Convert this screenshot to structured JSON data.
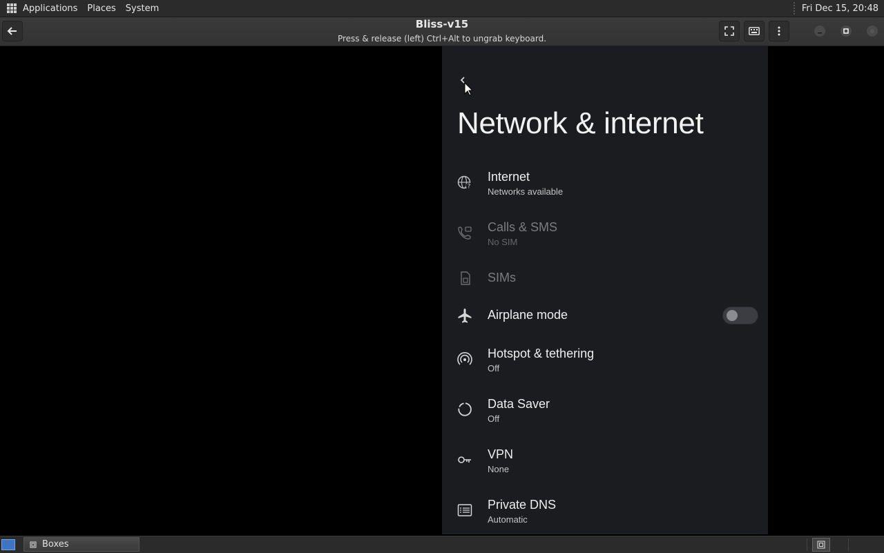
{
  "top_panel": {
    "menus": [
      "Applications",
      "Places",
      "System"
    ],
    "clock": "Fri Dec 15, 20:48"
  },
  "titlebar": {
    "title": "Bliss-v15",
    "subtitle": "Press & release (left) Ctrl+Alt to ungrab keyboard."
  },
  "android": {
    "page_title": "Network & internet",
    "items": [
      {
        "title": "Internet",
        "subtitle": "Networks available",
        "icon": "globe-question-icon",
        "enabled": true
      },
      {
        "title": "Calls & SMS",
        "subtitle": "No SIM",
        "icon": "phone-sms-icon",
        "enabled": false
      },
      {
        "title": "SIMs",
        "subtitle": "",
        "icon": "sim-card-icon",
        "enabled": false
      },
      {
        "title": "Airplane mode",
        "subtitle": "",
        "icon": "airplane-icon",
        "enabled": true,
        "toggle": false
      },
      {
        "title": "Hotspot & tethering",
        "subtitle": "Off",
        "icon": "hotspot-icon",
        "enabled": true
      },
      {
        "title": "Data Saver",
        "subtitle": "Off",
        "icon": "data-saver-icon",
        "enabled": true
      },
      {
        "title": "VPN",
        "subtitle": "None",
        "icon": "key-icon",
        "enabled": true
      },
      {
        "title": "Private DNS",
        "subtitle": "Automatic",
        "icon": "dns-icon",
        "enabled": true
      }
    ]
  },
  "taskbar": {
    "task_label": "Boxes"
  },
  "colors": {
    "android_bg": "#1b1c1f",
    "panel_bg": "#2b2b2b",
    "show_desktop": "#3d74c4"
  }
}
